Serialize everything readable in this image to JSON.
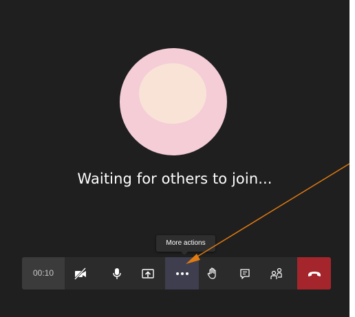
{
  "call": {
    "status_text": "Waiting for others to join...",
    "timer": "00:10"
  },
  "tooltip": {
    "text": "More actions"
  },
  "toolbar": {
    "buttons": [
      {
        "name": "camera-off-button",
        "icon": "camera-off-icon",
        "label": "Turn camera on"
      },
      {
        "name": "microphone-button",
        "icon": "microphone-icon",
        "label": "Mute"
      },
      {
        "name": "share-screen-button",
        "icon": "share-tray-icon",
        "label": "Share content"
      },
      {
        "name": "more-actions-button",
        "icon": "more-dots-icon",
        "label": "More actions",
        "active": true
      },
      {
        "name": "raise-hand-button",
        "icon": "hand-icon",
        "label": "Raise hand"
      },
      {
        "name": "chat-button",
        "icon": "chat-icon",
        "label": "Show conversation"
      },
      {
        "name": "participants-button",
        "icon": "people-icon",
        "label": "Show participants"
      },
      {
        "name": "hang-up-button",
        "icon": "phone-hangup-icon",
        "label": "Hang up"
      }
    ]
  },
  "colors": {
    "background": "#1f1f1f",
    "toolbar": "#2b2b2b",
    "hangup": "#a4262c",
    "avatar_outer": "#f4cdd7",
    "avatar_inner": "#f9e3d6",
    "annotation_arrow": "#e07a12"
  }
}
